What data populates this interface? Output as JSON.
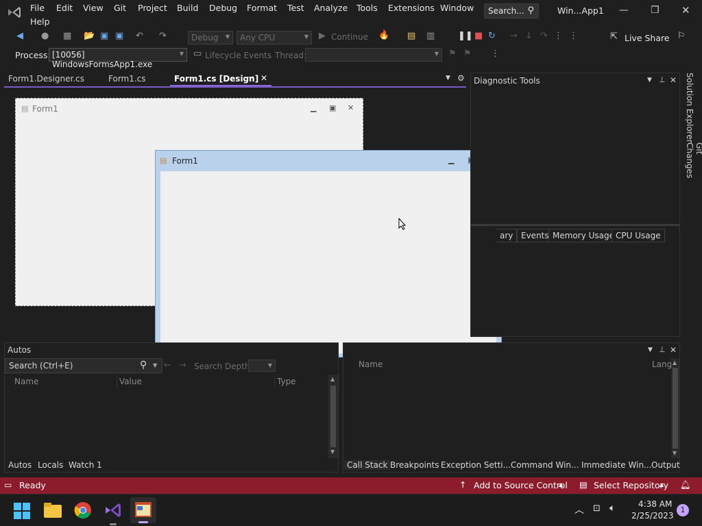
{
  "menu": {
    "items": [
      "File",
      "Edit",
      "View",
      "Git",
      "Project",
      "Build",
      "Debug",
      "Format",
      "Test",
      "Analyze",
      "Tools",
      "Extensions",
      "Window",
      "Help"
    ],
    "search_placeholder": "Search...",
    "window_title": "Win...App1"
  },
  "toolbar": {
    "config": "Debug",
    "platform": "Any CPU",
    "continue_label": "Continue",
    "live_share": "Live Share",
    "process_label": "Process:",
    "process_value": "[10056] WindowsFormsApp1.exe",
    "lifecycle_label": "Lifecycle Events",
    "thread_label": "Thread:"
  },
  "doc_tabs": [
    "Form1.Designer.cs",
    "Form1.cs",
    "Form1.cs [Design]"
  ],
  "designer_form": {
    "title": "Form1"
  },
  "running_form": {
    "title": "Form1"
  },
  "diagnostics": {
    "title": "Diagnostic Tools",
    "tabs": [
      "ary",
      "Events",
      "Memory Usage",
      "CPU Usage"
    ]
  },
  "side_strip": [
    "Solution Explorer",
    "Git Changes"
  ],
  "autos": {
    "title": "Autos",
    "search": "Search (Ctrl+E)",
    "search_depth": "Search Depth:",
    "columns": [
      "Name",
      "Value",
      "Type"
    ],
    "tabs": [
      "Autos",
      "Locals",
      "Watch 1"
    ]
  },
  "callstack": {
    "columns": [
      "Name",
      "Lang"
    ],
    "tabs": [
      "Call Stack",
      "Breakpoints",
      "Exception Setti...",
      "Command Win...",
      "Immediate Win...",
      "Output"
    ]
  },
  "status": {
    "text": "Ready",
    "add_source": "Add to Source Control",
    "select_repo": "Select Repository"
  },
  "taskbar": {
    "time": "4:38 AM",
    "date": "2/25/2023",
    "notification_count": "1"
  },
  "colors": {
    "status_bar": "#8c1c2c",
    "accent": "#7a5bc7"
  }
}
